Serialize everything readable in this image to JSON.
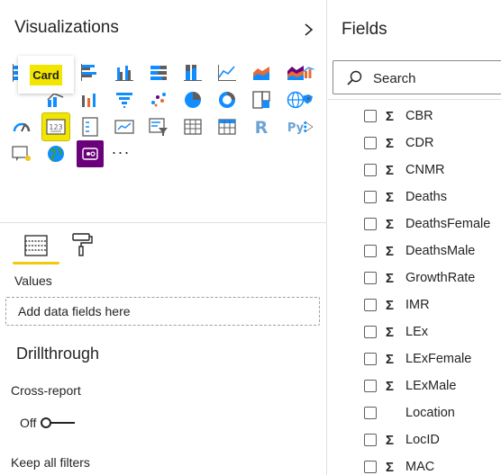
{
  "visualizations": {
    "title": "Visualizations",
    "tooltip": "Card",
    "values_label": "Values",
    "drop_placeholder": "Add data fields here",
    "drillthrough_title": "Drillthrough",
    "cross_report_label": "Cross-report",
    "toggle_state": "Off",
    "keep_filters_label": "Keep all filters",
    "more_label": "···",
    "r_label": "R",
    "py_label": "Py"
  },
  "fields": {
    "title": "Fields",
    "search_placeholder": "Search",
    "items": [
      {
        "name": "CBR",
        "numeric": true
      },
      {
        "name": "CDR",
        "numeric": true
      },
      {
        "name": "CNMR",
        "numeric": true
      },
      {
        "name": "Deaths",
        "numeric": true
      },
      {
        "name": "DeathsFemale",
        "numeric": true
      },
      {
        "name": "DeathsMale",
        "numeric": true
      },
      {
        "name": "GrowthRate",
        "numeric": true
      },
      {
        "name": "IMR",
        "numeric": true
      },
      {
        "name": "LEx",
        "numeric": true
      },
      {
        "name": "LExFemale",
        "numeric": true
      },
      {
        "name": "LExMale",
        "numeric": true
      },
      {
        "name": "Location",
        "numeric": false
      },
      {
        "name": "LocID",
        "numeric": true
      },
      {
        "name": "MAC",
        "numeric": true
      }
    ],
    "sigma_symbol": "Σ"
  },
  "colors": {
    "accent_yellow": "#f2e600",
    "tab_underline": "#f2c811",
    "chart_blue": "#118dff",
    "chart_orange": "#e66c37",
    "chart_purple": "#6b007b",
    "chart_dark": "#605e5c"
  }
}
